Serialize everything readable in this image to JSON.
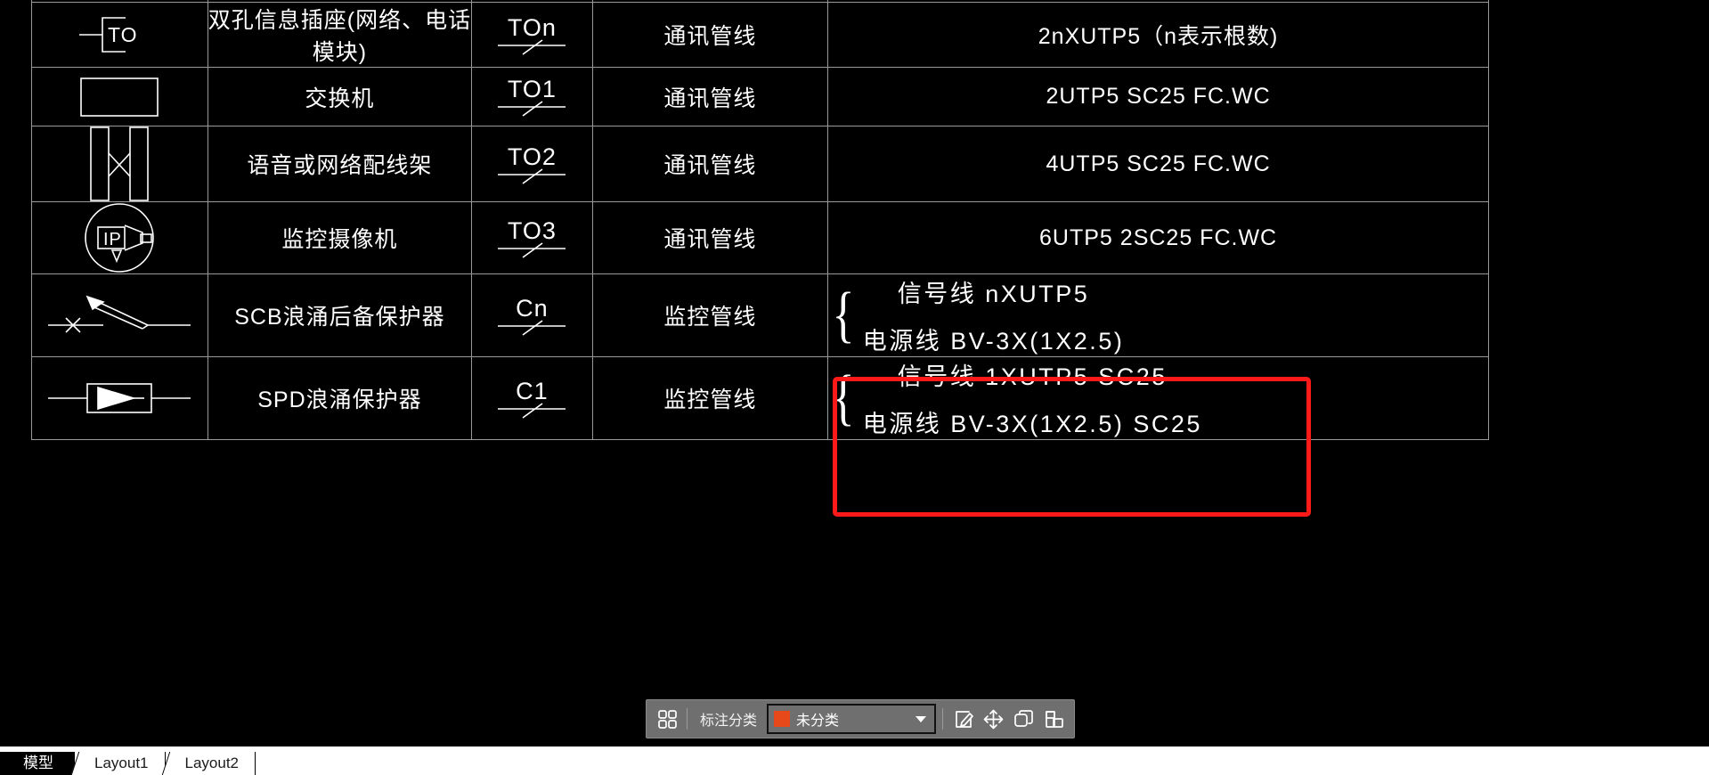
{
  "app": {
    "canvas_background": "#000000",
    "line_color": "#9a9a9a",
    "text_color": "#ffffff",
    "annotation_color": "#ff1a1a"
  },
  "legend_table": {
    "columns": [
      "symbol",
      "description",
      "code",
      "category",
      "specification"
    ],
    "rows": [
      {
        "symbol_icon": "clipped-top-row-icon",
        "description": "",
        "code": "",
        "category": "",
        "specification": ""
      },
      {
        "symbol_icon": "information-outlet-to-icon",
        "symbol_text": "TO",
        "description": "双孔信息插座(网络、电话模块)",
        "code": "TOn",
        "category": "通讯管线",
        "specification": "2nXUTP5（n表示根数)"
      },
      {
        "symbol_icon": "switch-box-icon",
        "description": "交换机",
        "code": "TO1",
        "category": "通讯管线",
        "specification": "2UTP5  SC25  FC.WC"
      },
      {
        "symbol_icon": "patch-panel-icon",
        "description": "语音或网络配线架",
        "code": "TO2",
        "category": "通讯管线",
        "specification": "4UTP5  SC25  FC.WC"
      },
      {
        "symbol_icon": "ip-camera-icon",
        "symbol_text": "IP",
        "description": "监控摄像机",
        "code": "TO3",
        "category": "通讯管线",
        "specification": "6UTP5  2SC25  FC.WC"
      },
      {
        "symbol_icon": "scb-surge-backup-protector-icon",
        "description": "SCB浪涌后备保护器",
        "code": "Cn",
        "category": "监控管线",
        "spec_brace": [
          "信号线  nXUTP5",
          "电源线  BV-3X(1X2.5)"
        ]
      },
      {
        "symbol_icon": "spd-surge-protector-icon",
        "description": "SPD浪涌保护器",
        "code": "C1",
        "category": "监控管线",
        "spec_brace": [
          "信号线  1XUTP5  SC25",
          "电源线  BV-3X(1X2.5)  SC25"
        ]
      }
    ]
  },
  "annotation": {
    "shape": "rectangle",
    "color": "#ff1a1a",
    "target": "C1 监控管线 specification cell"
  },
  "toolbar": {
    "grid_icon": "four-squares-icon",
    "label": "标注分类",
    "category_select": {
      "value": "未分类",
      "swatch_color": "#e8491b",
      "caret_icon": "chevron-down-icon"
    },
    "buttons": [
      {
        "name": "edit-annotation-button",
        "icon": "pencil-page-icon"
      },
      {
        "name": "move-button",
        "icon": "four-way-move-icon"
      },
      {
        "name": "copy-button",
        "icon": "copy-squares-icon"
      },
      {
        "name": "paste-button",
        "icon": "paste-clipboard-icon"
      }
    ]
  },
  "layout_tabs": {
    "items": [
      {
        "label": "模型",
        "active": true
      },
      {
        "label": "Layout1",
        "active": false
      },
      {
        "label": "Layout2",
        "active": false
      }
    ]
  }
}
